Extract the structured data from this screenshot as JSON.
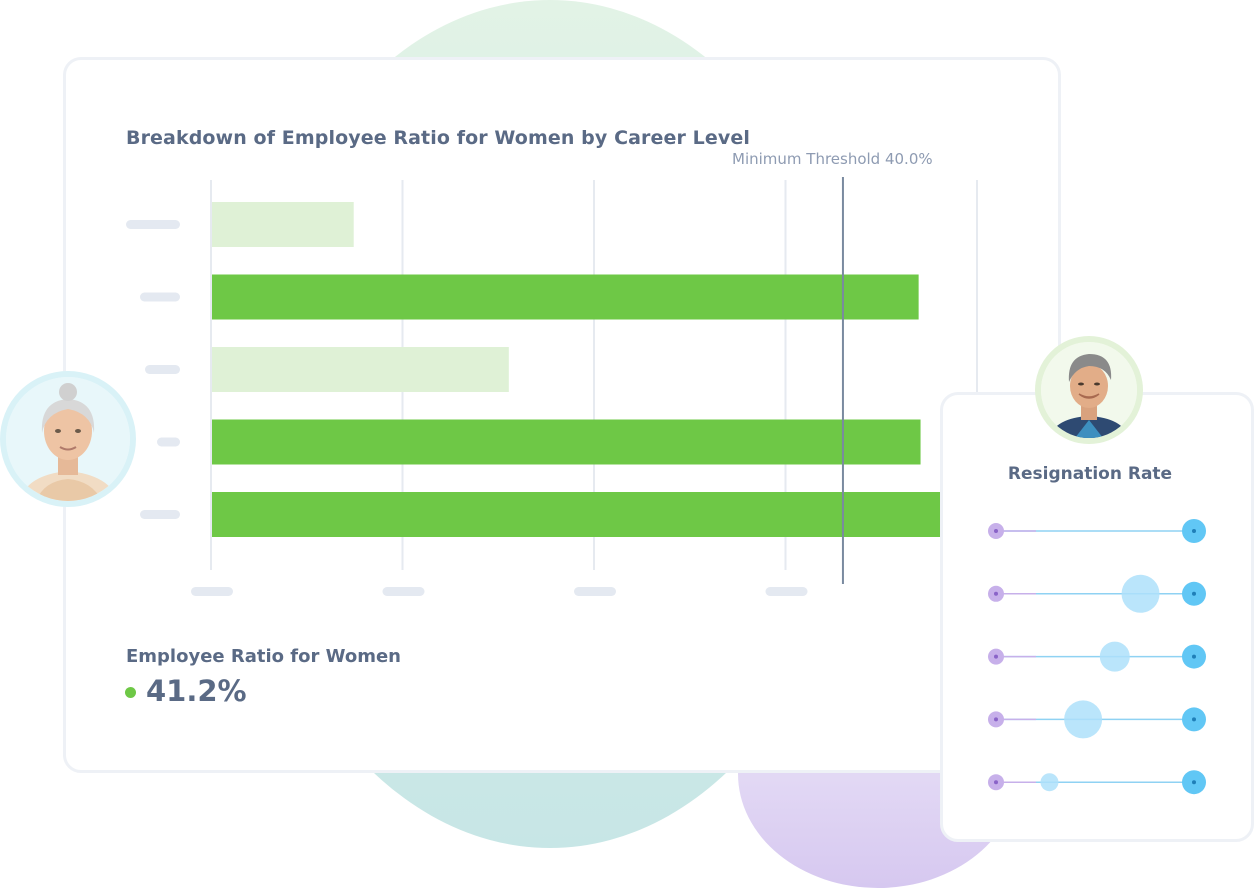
{
  "chart_data": [
    {
      "type": "bar",
      "orientation": "horizontal",
      "title": "Breakdown of Employee Ratio for Women by Career Level",
      "categories": [
        "",
        "",
        "",
        "",
        ""
      ],
      "values": [
        0.74,
        3.69,
        1.55,
        3.7,
        3.84
      ],
      "series_highlight": [
        false,
        true,
        false,
        true,
        true
      ],
      "xlim": [
        0,
        4.0
      ],
      "grid": true,
      "threshold": {
        "label": "Minimum Threshold 40.0%",
        "value": 3.3
      },
      "colors": {
        "bar": "#6ec846",
        "bar_muted": "#dff1d6",
        "grid": "#e6eaf0",
        "threshold": "#7a8aa0",
        "placeholder": "#e4e9f1"
      }
    },
    {
      "type": "scatter",
      "title": "Resignation Rate",
      "rows": [
        {
          "start": 0,
          "end": 1.0,
          "bubble": null,
          "bubble_size": 0
        },
        {
          "start": 0,
          "end": 1.0,
          "bubble": 0.73,
          "bubble_size": 3
        },
        {
          "start": 0,
          "end": 1.0,
          "bubble": 0.6,
          "bubble_size": 2
        },
        {
          "start": 0,
          "end": 1.0,
          "bubble": 0.44,
          "bubble_size": 3
        },
        {
          "start": 0,
          "end": 1.0,
          "bubble": 0.27,
          "bubble_size": 1
        }
      ],
      "colors": {
        "start": "#c7b0ea",
        "end": "#61c7f5",
        "bubble": "#aee0fa",
        "line": "#8fd2f3"
      }
    }
  ],
  "metric": {
    "label": "Employee Ratio for Women",
    "value": "41.2%",
    "dot_color": "#6ec846"
  },
  "avatars": {
    "left": "avatar-woman",
    "right": "avatar-man"
  }
}
